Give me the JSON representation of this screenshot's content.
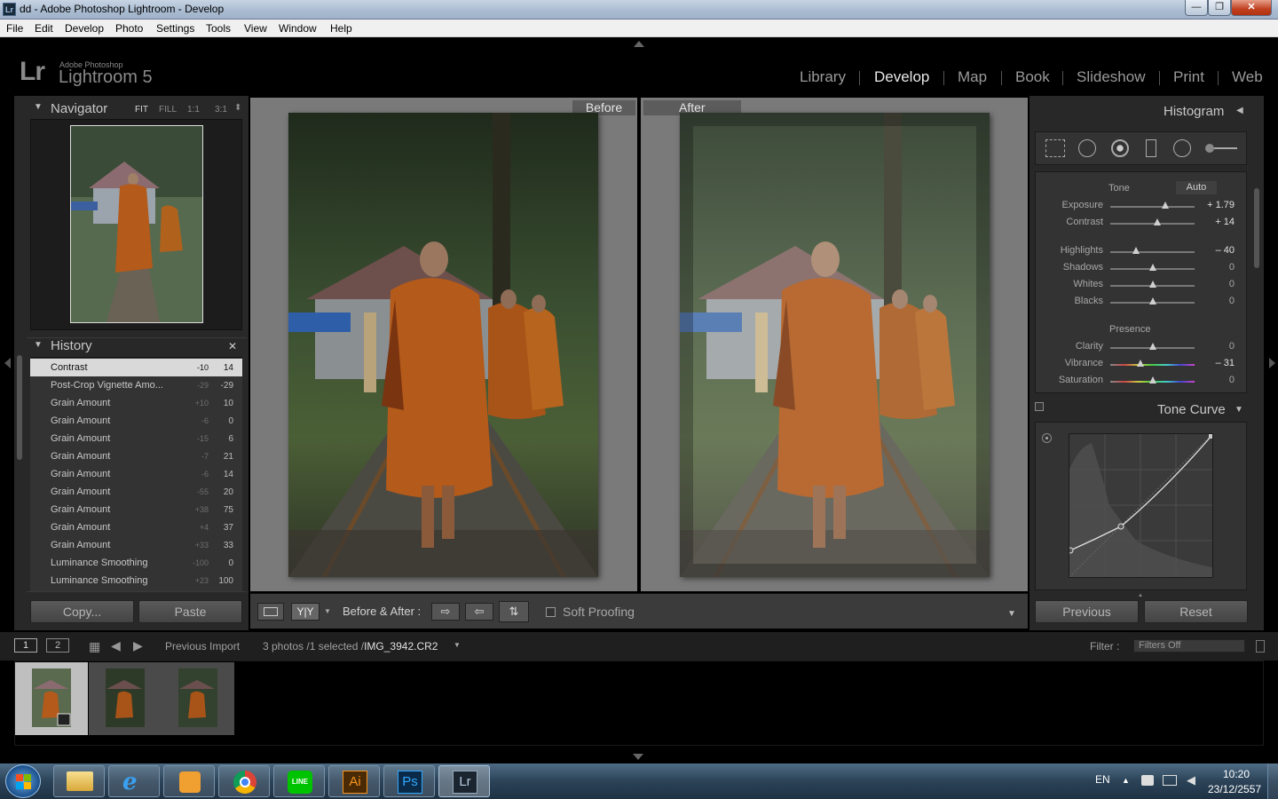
{
  "window": {
    "icon_text": "Lr",
    "title": "dd - Adobe Photoshop Lightroom - Develop",
    "min_label": "—",
    "max_label": "❐",
    "close_label": "✕"
  },
  "menu": [
    "File",
    "Edit",
    "Develop",
    "Photo",
    "Settings",
    "Tools",
    "View",
    "Window",
    "Help"
  ],
  "brand": {
    "logo": "Lr",
    "small": "Adobe Photoshop",
    "big": "Lightroom 5"
  },
  "modules": [
    "Library",
    "Develop",
    "Map",
    "Book",
    "Slideshow",
    "Print",
    "Web"
  ],
  "navigator": {
    "title": "Navigator",
    "zoom": [
      "FIT",
      "FILL",
      "1:1",
      "3:1"
    ]
  },
  "history": {
    "title": "History",
    "close": "✕",
    "items": [
      {
        "label": "Contrast",
        "before": "-10",
        "after": "14"
      },
      {
        "label": "Post-Crop Vignette Amo...",
        "before": "-29",
        "after": "-29"
      },
      {
        "label": "Grain Amount",
        "before": "+10",
        "after": "10"
      },
      {
        "label": "Grain Amount",
        "before": "-6",
        "after": "0"
      },
      {
        "label": "Grain Amount",
        "before": "-15",
        "after": "6"
      },
      {
        "label": "Grain Amount",
        "before": "-7",
        "after": "21"
      },
      {
        "label": "Grain Amount",
        "before": "-6",
        "after": "14"
      },
      {
        "label": "Grain Amount",
        "before": "-55",
        "after": "20"
      },
      {
        "label": "Grain Amount",
        "before": "+38",
        "after": "75"
      },
      {
        "label": "Grain Amount",
        "before": "+4",
        "after": "37"
      },
      {
        "label": "Grain Amount",
        "before": "+33",
        "after": "33"
      },
      {
        "label": "Luminance Smoothing",
        "before": "-100",
        "after": "0"
      },
      {
        "label": "Luminance Smoothing",
        "before": "+23",
        "after": "100"
      }
    ]
  },
  "left_buttons": {
    "copy": "Copy...",
    "paste": "Paste"
  },
  "compare": {
    "before": "Before",
    "after": "After"
  },
  "toolbar": {
    "ba_label": "Before & After :",
    "soft_proofing": "Soft Proofing",
    "yy": "Y|Y"
  },
  "histogram": {
    "title": "Histogram"
  },
  "basic": {
    "tone_label": "Tone",
    "auto_label": "Auto",
    "presence_label": "Presence",
    "sliders": [
      {
        "label": "Exposure",
        "value": "+ 1.79",
        "level": 0.65
      },
      {
        "label": "Contrast",
        "value": "+ 14",
        "level": 0.56
      },
      {
        "label": "Highlights",
        "value": "– 40",
        "level": 0.3
      },
      {
        "label": "Shadows",
        "value": "0",
        "level": 0.5
      },
      {
        "label": "Whites",
        "value": "0",
        "level": 0.5
      },
      {
        "label": "Blacks",
        "value": "0",
        "level": 0.5
      },
      {
        "label": "Clarity",
        "value": "0",
        "level": 0.5
      },
      {
        "label": "Vibrance",
        "value": "– 31",
        "level": 0.36
      },
      {
        "label": "Saturation",
        "value": "0",
        "level": 0.5
      }
    ]
  },
  "tone_curve": {
    "title": "Tone Curve"
  },
  "right_buttons": {
    "previous": "Previous",
    "reset": "Reset"
  },
  "filmstrip": {
    "screen1": "1",
    "screen2": "2",
    "source": "Previous Import",
    "info_prefix": "3 photos /1 selected /",
    "filename": "IMG_3942.CR2",
    "filter_label": "Filter :",
    "filter_value": "Filters Off",
    "thumb_count": 3
  },
  "taskbar": {
    "apps": [
      "explorer",
      "ie",
      "media-player",
      "chrome",
      "line",
      "illustrator",
      "photoshop",
      "lightroom"
    ],
    "line_label": "LINE",
    "ai_label": "Ai",
    "ps_label": "Ps",
    "lr_label": "Lr",
    "lang": "EN",
    "time": "10:20",
    "date": "23/12/2557"
  },
  "colors": {
    "panel": "#282828",
    "selected_row": "#d9d9d9",
    "robe": "#b45a1a"
  }
}
